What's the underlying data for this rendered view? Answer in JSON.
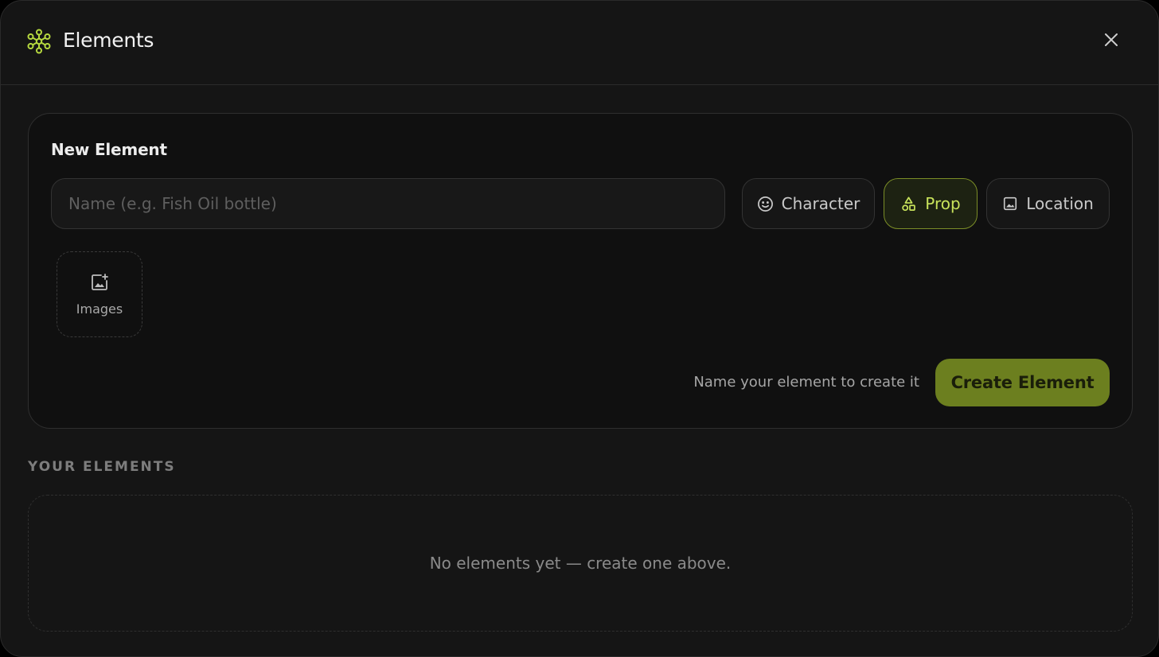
{
  "header": {
    "title": "Elements",
    "icon": "elements-network-icon",
    "close_icon": "close-icon"
  },
  "new_element": {
    "title": "New Element",
    "name_placeholder": "Name (e.g. Fish Oil bottle)",
    "name_value": "",
    "types": [
      {
        "label": "Character",
        "icon": "smiley-icon",
        "selected": false
      },
      {
        "label": "Prop",
        "icon": "shapes-icon",
        "selected": true
      },
      {
        "label": "Location",
        "icon": "image-icon",
        "selected": false
      }
    ],
    "images_label": "Images",
    "hint": "Name your element to create it",
    "create_label": "Create Element"
  },
  "your_elements": {
    "label": "YOUR ELEMENTS",
    "empty_text": "No elements yet — create one above."
  },
  "colors": {
    "accent": "#b6d93f",
    "accent_button": "#6c7f1f",
    "background": "#151515"
  }
}
